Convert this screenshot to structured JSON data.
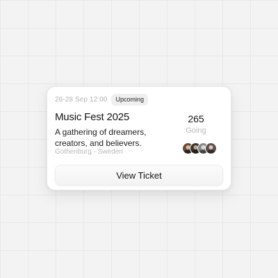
{
  "event": {
    "date": "26-28 Sep 12:00",
    "status": "Upcoming",
    "title": "Music Fest 2025",
    "description": "A gathering of dreamers, creators, and believers.",
    "location": "Gothenburg - Sweden",
    "attendee_count": "265",
    "attendee_label": "Going",
    "avatar_colors": [
      "#6b4a3a",
      "#3d3530",
      "#8a8a8a",
      "#5a5250"
    ]
  },
  "actions": {
    "view_ticket_label": "View Ticket"
  }
}
